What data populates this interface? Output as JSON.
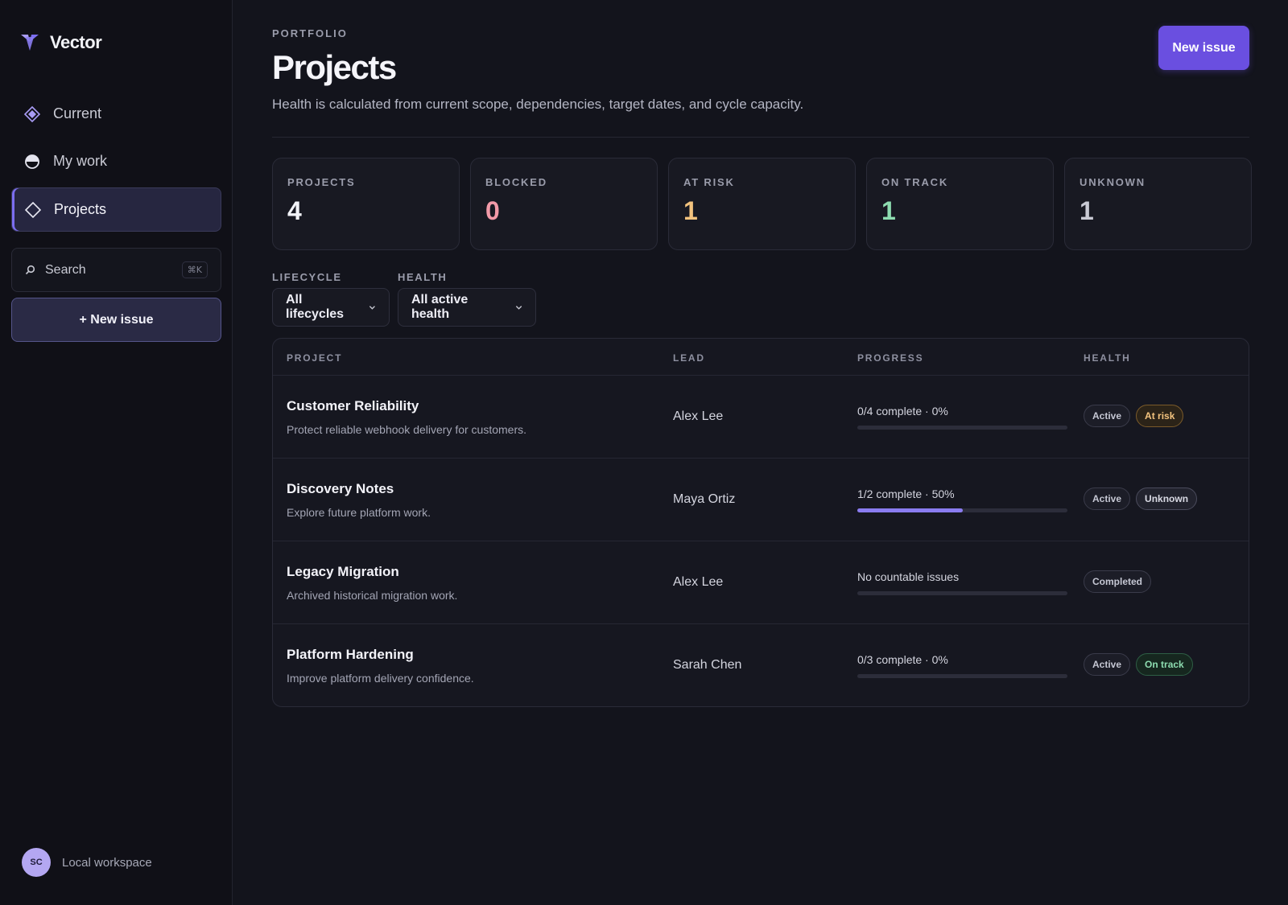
{
  "brand": {
    "name": "Vector"
  },
  "sidebar": {
    "items": [
      {
        "label": "Current",
        "icon": "diamond-filled-icon",
        "active": false
      },
      {
        "label": "My work",
        "icon": "half-circle-icon",
        "active": false
      },
      {
        "label": "Projects",
        "icon": "diamond-outline-icon",
        "active": true
      }
    ],
    "search": {
      "label": "Search",
      "shortcut": "⌘K"
    },
    "new_issue_label": "+ New issue",
    "workspace": {
      "avatar_initials": "SC",
      "label": "Local workspace"
    }
  },
  "header": {
    "eyebrow": "PORTFOLIO",
    "title": "Projects",
    "subtitle": "Health is calculated from current scope, dependencies, target dates, and cycle capacity.",
    "new_issue_label": "New issue"
  },
  "stats": [
    {
      "label": "PROJECTS",
      "value": "4",
      "color": "#f2f3f8"
    },
    {
      "label": "BLOCKED",
      "value": "0",
      "color": "#f29aa8"
    },
    {
      "label": "AT RISK",
      "value": "1",
      "color": "#f3c37e"
    },
    {
      "label": "ON TRACK",
      "value": "1",
      "color": "#8ddcb0"
    },
    {
      "label": "UNKNOWN",
      "value": "1",
      "color": "#c9cad4"
    }
  ],
  "filters": {
    "lifecycle": {
      "label": "LIFECYCLE",
      "value": "All lifecycles"
    },
    "health": {
      "label": "HEALTH",
      "value": "All active health"
    }
  },
  "table": {
    "columns": [
      "PROJECT",
      "LEAD",
      "PROGRESS",
      "HEALTH"
    ],
    "rows": [
      {
        "name": "Customer Reliability",
        "description": "Protect reliable webhook delivery for customers.",
        "lead": "Alex Lee",
        "progress_text": "0/4 complete · 0%",
        "progress": 0,
        "badges": [
          {
            "label": "Active",
            "kind": "neutral"
          },
          {
            "label": "At risk",
            "kind": "risk"
          }
        ]
      },
      {
        "name": "Discovery Notes",
        "description": "Explore future platform work.",
        "lead": "Maya Ortiz",
        "progress_text": "1/2 complete · 50%",
        "progress": 0.5,
        "badges": [
          {
            "label": "Active",
            "kind": "neutral"
          },
          {
            "label": "Unknown",
            "kind": "unknown"
          }
        ]
      },
      {
        "name": "Legacy Migration",
        "description": "Archived historical migration work.",
        "lead": "Alex Lee",
        "progress_text": "No countable issues",
        "progress": 0,
        "badges": [
          {
            "label": "Completed",
            "kind": "neutral"
          }
        ]
      },
      {
        "name": "Platform Hardening",
        "description": "Improve platform delivery confidence.",
        "lead": "Sarah Chen",
        "progress_text": "0/3 complete · 0%",
        "progress": 0,
        "badges": [
          {
            "label": "Active",
            "kind": "neutral"
          },
          {
            "label": "On track",
            "kind": "ontrack"
          }
        ]
      }
    ]
  }
}
